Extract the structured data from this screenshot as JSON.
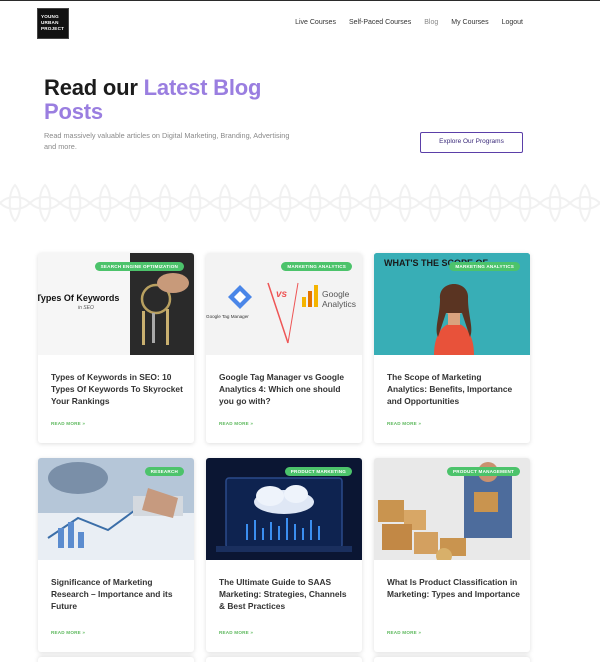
{
  "brand": {
    "logo_lines": [
      "YOUNG",
      "URBAN",
      "PROJECT"
    ]
  },
  "nav": {
    "items": [
      {
        "label": "Live Courses"
      },
      {
        "label": "Self-Paced Courses"
      },
      {
        "label": "Blog"
      },
      {
        "label": "My Courses"
      },
      {
        "label": "Logout"
      }
    ]
  },
  "hero": {
    "title_part1": "Read our ",
    "title_accent": "Latest Blog",
    "title_part2": "Posts",
    "subtitle": "Read massively valuable articles on Digital Marketing, Branding, Advertising and more.",
    "cta_label": "Explore Our Programs"
  },
  "posts": [
    {
      "category": "SEARCH ENGINE OPTIMIZATION",
      "title": "Types of Keywords in SEO: 10 Types Of Keywords To Skyrocket Your Rankings",
      "read_more": "READ MORE »",
      "thumb_text": "Types Of Keywords",
      "thumb_sub": "in SEO"
    },
    {
      "category": "MARKETING ANALYTICS",
      "title": "Google Tag Manager vs Google Analytics 4: Which one should you go with?",
      "read_more": "READ MORE »",
      "thumb_left": "Google Tag Manager",
      "thumb_vs": "vs",
      "thumb_right_1": "Google",
      "thumb_right_2": "Analytics"
    },
    {
      "category": "MARKETING ANALYTICS",
      "title": "The Scope of Marketing Analytics: Benefits, Importance and Opportunities",
      "read_more": "READ MORE »",
      "thumb_text": "WHAT'S THE SCOPE OF"
    },
    {
      "category": "RESEARCH",
      "title": "Significance of Marketing Research – Importance and its Future",
      "read_more": "READ MORE »"
    },
    {
      "category": "PRODUCT MARKETING",
      "title": "The Ultimate Guide to SAAS Marketing: Strategies, Channels & Best Practices",
      "read_more": "READ MORE »"
    },
    {
      "category": "PRODUCT MANAGEMENT",
      "title": "What Is Product Classification in Marketing: Types and Importance",
      "read_more": "READ MORE »"
    }
  ],
  "colors": {
    "accent_purple": "#9a7ee0",
    "badge_green": "#4cc36b",
    "read_more_green": "#5cb85c",
    "cta_border": "#5b3fa8"
  }
}
